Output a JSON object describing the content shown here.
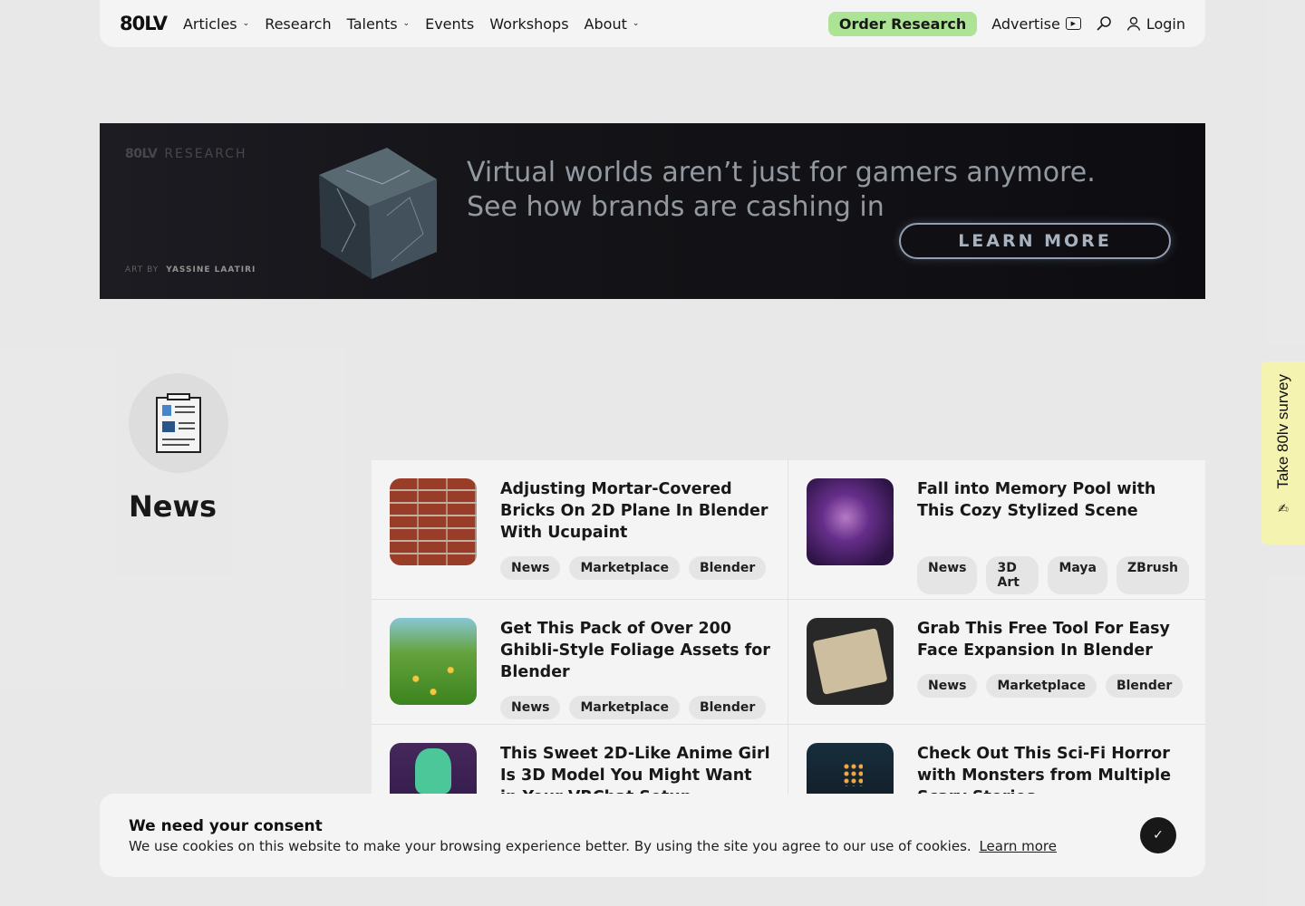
{
  "header": {
    "logo": "80LV",
    "nav": [
      {
        "label": "Articles",
        "dropdown": true
      },
      {
        "label": "Research",
        "dropdown": false
      },
      {
        "label": "Talents",
        "dropdown": true
      },
      {
        "label": "Events",
        "dropdown": false
      },
      {
        "label": "Workshops",
        "dropdown": false
      },
      {
        "label": "About",
        "dropdown": true
      }
    ],
    "order_research": "Order Research",
    "advertise": "Advertise",
    "login": "Login"
  },
  "banner": {
    "brand_logo": "80LV",
    "brand_section": "RESEARCH",
    "headline_line1": "Virtual worlds aren’t just for gamers anymore.",
    "headline_line2": "See how brands are cashing in",
    "cta": "LEARN MORE",
    "credit_prefix": "ART BY",
    "credit_artist": "YASSINE LAATIRI"
  },
  "section": {
    "title": "News"
  },
  "articles": [
    {
      "title": "Adjusting Mortar-Covered Bricks On 2D Plane In Blender With Ucupaint",
      "tags": [
        "News",
        "Marketplace",
        "Blender"
      ]
    },
    {
      "title": "Fall into Memory Pool with This Cozy Stylized Scene",
      "tags": [
        "News",
        "3D Art",
        "Maya",
        "ZBrush"
      ]
    },
    {
      "title": "Get This Pack of Over 200 Ghibli-Style Foliage Assets for Blender",
      "tags": [
        "News",
        "Marketplace",
        "Blender"
      ]
    },
    {
      "title": "Grab This Free Tool For Easy Face Expansion In Blender",
      "tags": [
        "News",
        "Marketplace",
        "Blender"
      ]
    },
    {
      "title": "This Sweet 2D-Like Anime Girl Is 3D Model You Might Want in Your VRChat Setup",
      "tags": []
    },
    {
      "title": "Check Out This Sci-Fi Horror with Monsters from Multiple Scary Stories",
      "tags": []
    }
  ],
  "survey": {
    "label": "Take 80lv survey"
  },
  "consent": {
    "title": "We need your consent",
    "text": "We use cookies on this website to make your browsing experience better. By using the site you agree to our use of cookies.",
    "link": "Learn more"
  },
  "colors": {
    "accent_green": "#b5ee9c",
    "survey_yellow": "#ffffb8"
  }
}
